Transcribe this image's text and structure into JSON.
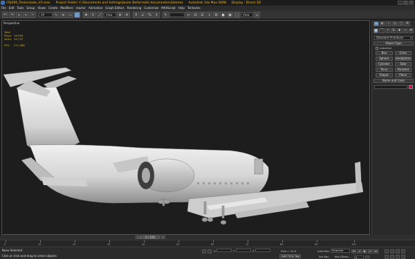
{
  "titlebar": {
    "file": "CRJ200_Texturizado_V3.max",
    "project": "Project Folder: C:\\Documents and Settings\\Javier Bellorrado\\ documentos\\3dsmax",
    "app": "Autodesk 3ds Max 2008",
    "display": "Display : Direct 3D"
  },
  "menu": [
    "File",
    "Edit",
    "Tools",
    "Group",
    "Views",
    "Create",
    "Modifiers",
    "reactor",
    "Animation",
    "Graph Editors",
    "Rendering",
    "Customize",
    "MAXScript",
    "Help",
    "Tentacles"
  ],
  "toolbar": {
    "selection_filter": "All",
    "coord_system": "View",
    "view_dropdown": "View"
  },
  "viewport": {
    "label": "Perspective",
    "stats": {
      "total_label": "Total",
      "polys_label": "Polys:",
      "polys_value": "16,999",
      "verts_label": "Verts:",
      "verts_value": "19,737",
      "fps_label": "FPS:",
      "fps_value": "271.968"
    }
  },
  "command_panel": {
    "category": "Standard Primitives",
    "object_type_title": "Object Type",
    "autogrid": "AutoGrid",
    "objects": [
      "Box",
      "Cone",
      "Sphere",
      "GeoSphere",
      "Cylinder",
      "Tube",
      "Torus",
      "Pyramid",
      "Teapot",
      "Plane"
    ],
    "name_color_title": "Name and Color",
    "swatch_color": "#c8104b"
  },
  "timeline": {
    "position_label": "0 / 100",
    "ruler_labels": [
      "0",
      "10",
      "20",
      "30",
      "40",
      "50",
      "60",
      "70",
      "80",
      "90",
      "100"
    ]
  },
  "status": {
    "selection": "None Selected",
    "prompt": "Click or click-and-drag to select objects",
    "grid": "Grid = 10,0",
    "add_time_tag": "Add Time Tag",
    "auto_key": "Auto Key",
    "selected": "Selected",
    "set_key": "Set Key",
    "key_filters": "Key Filters...",
    "frame": "0",
    "x_label": "X",
    "y_label": "Y",
    "z_label": "Z"
  }
}
